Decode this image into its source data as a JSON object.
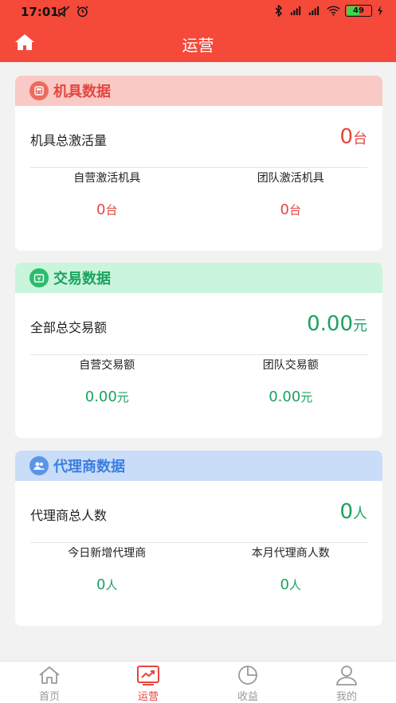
{
  "status_bar": {
    "time": "17:01",
    "battery": "49"
  },
  "header": {
    "title": "运营"
  },
  "colors": {
    "accent": "#f5493a",
    "red_value": "#e5463e",
    "green_value": "#1aa260"
  },
  "machine_card": {
    "title": "机具数据",
    "total_label": "机具总激活量",
    "total_value": "0",
    "total_unit": "台",
    "left_label": "自营激活机具",
    "left_value": "0",
    "left_unit": "台",
    "right_label": "团队激活机具",
    "right_value": "0",
    "right_unit": "台"
  },
  "trade_card": {
    "title": "交易数据",
    "total_label": "全部总交易额",
    "total_value": "0.00",
    "total_unit": "元",
    "left_label": "自营交易额",
    "left_value": "0.00",
    "left_unit": "元",
    "right_label": "团队交易额",
    "right_value": "0.00",
    "right_unit": "元"
  },
  "agent_card": {
    "title": "代理商数据",
    "total_label": "代理商总人数",
    "total_value": "0",
    "total_unit": "人",
    "left_label": "今日新增代理商",
    "left_value": "0",
    "left_unit": "人",
    "right_label": "本月代理商人数",
    "right_value": "0",
    "right_unit": "人"
  },
  "tabbar": {
    "items": [
      {
        "label": "首页",
        "icon": "home-icon"
      },
      {
        "label": "运营",
        "icon": "trend-chart-icon"
      },
      {
        "label": "收益",
        "icon": "pie-chart-icon"
      },
      {
        "label": "我的",
        "icon": "user-icon"
      }
    ],
    "active": "运营"
  }
}
